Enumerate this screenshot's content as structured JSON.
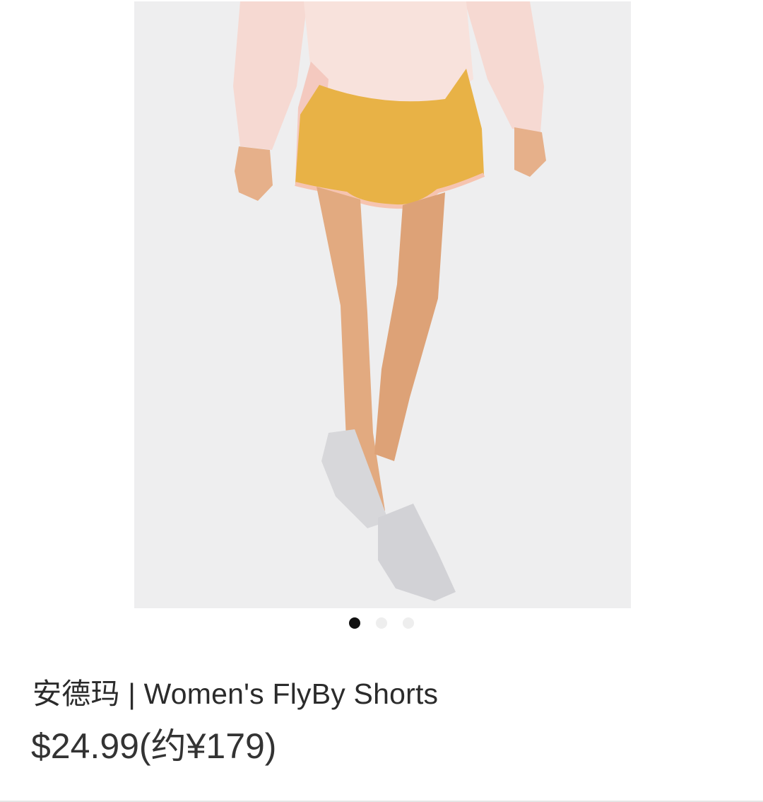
{
  "product": {
    "title": "安德玛 | Women's FlyBy Shorts",
    "price": "$24.99(约¥179)",
    "image_alt": "Women's FlyBy Shorts product photo"
  },
  "carousel": {
    "total_slides": 3,
    "active_index": 0
  },
  "colors": {
    "image_background": "#eeeeef",
    "shorts": "#e8b246",
    "shorts_trim": "#f6c4b0",
    "shirt": "#f8dcd6",
    "skin": "#e3ad84",
    "shoes": "#d7d7da",
    "dot_active": "#111111",
    "dot_inactive": "#eeeeee"
  }
}
